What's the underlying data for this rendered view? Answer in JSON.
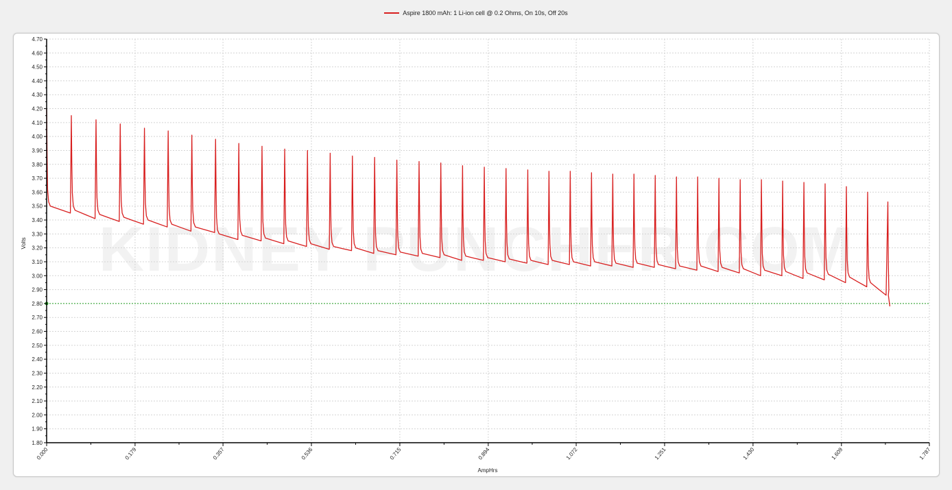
{
  "legend": {
    "label": "Aspire 1800 mAh: 1 Li-ion cell @ 0.2 Ohms, On 10s, Off 20s",
    "color": "#d81e1e"
  },
  "watermark": "KIDNEY PUNCHER.COM",
  "colors": {
    "series": "#d81e1e",
    "cutoff": "#22a022",
    "grid": "#d4d4d4",
    "axis": "#000000"
  },
  "chart_data": {
    "type": "line",
    "xlabel": "AmpHrs",
    "ylabel": "Volts",
    "xlim": [
      0,
      1.787
    ],
    "ylim": [
      1.8,
      4.7
    ],
    "x_ticks": [
      "0.000",
      "0.179",
      "0.357",
      "0.536",
      "0.715",
      "0.894",
      "1.072",
      "1.251",
      "1.430",
      "1.609",
      "1.787"
    ],
    "y_ticks": [
      "1.80",
      "1.90",
      "2.00",
      "2.10",
      "2.20",
      "2.30",
      "2.40",
      "2.50",
      "2.60",
      "2.70",
      "2.80",
      "2.90",
      "3.00",
      "3.10",
      "3.20",
      "3.30",
      "3.40",
      "3.50",
      "3.60",
      "3.70",
      "3.80",
      "3.90",
      "4.00",
      "4.10",
      "4.20",
      "4.30",
      "4.40",
      "4.50",
      "4.60",
      "4.70"
    ],
    "grid": true,
    "cutoff_voltage": 2.8,
    "series": [
      {
        "name": "Aspire 1800 mAh: 1 Li-ion cell @ 0.2 Ohms, On 10s, Off 20s",
        "pulses": {
          "start_x": [
            0.0,
            0.05,
            0.1,
            0.149,
            0.198,
            0.246,
            0.294,
            0.342,
            0.389,
            0.436,
            0.482,
            0.528,
            0.574,
            0.619,
            0.664,
            0.709,
            0.754,
            0.798,
            0.842,
            0.886,
            0.93,
            0.974,
            1.017,
            1.06,
            1.103,
            1.146,
            1.189,
            1.232,
            1.275,
            1.318,
            1.361,
            1.404,
            1.447,
            1.49,
            1.533,
            1.576,
            1.619,
            1.662
          ],
          "peak_v": [
            4.2,
            4.15,
            4.12,
            4.09,
            4.06,
            4.04,
            4.01,
            3.98,
            3.95,
            3.93,
            3.91,
            3.9,
            3.88,
            3.86,
            3.85,
            3.83,
            3.82,
            3.81,
            3.79,
            3.78,
            3.77,
            3.76,
            3.75,
            3.75,
            3.74,
            3.73,
            3.73,
            3.72,
            3.71,
            3.71,
            3.7,
            3.69,
            3.69,
            3.68,
            3.67,
            3.66,
            3.64,
            3.6
          ],
          "loaded_start_v": [
            3.5,
            3.47,
            3.44,
            3.42,
            3.4,
            3.37,
            3.35,
            3.3,
            3.29,
            3.27,
            3.25,
            3.23,
            3.21,
            3.2,
            3.18,
            3.17,
            3.16,
            3.15,
            3.14,
            3.13,
            3.12,
            3.11,
            3.11,
            3.1,
            3.1,
            3.09,
            3.09,
            3.08,
            3.07,
            3.07,
            3.06,
            3.05,
            3.04,
            3.03,
            3.02,
            3.01,
            2.99,
            2.95
          ],
          "loaded_end_v": [
            3.45,
            3.41,
            3.39,
            3.37,
            3.35,
            3.32,
            3.31,
            3.26,
            3.25,
            3.23,
            3.21,
            3.19,
            3.18,
            3.16,
            3.15,
            3.14,
            3.13,
            3.11,
            3.11,
            3.1,
            3.09,
            3.08,
            3.08,
            3.07,
            3.07,
            3.06,
            3.06,
            3.05,
            3.04,
            3.03,
            3.02,
            3.0,
            3.0,
            2.98,
            2.97,
            2.95,
            2.92,
            2.86
          ],
          "final_peak_v": 3.53,
          "final_peak_x": 1.703,
          "end_x": 1.707,
          "end_v": 2.78
        }
      }
    ]
  }
}
